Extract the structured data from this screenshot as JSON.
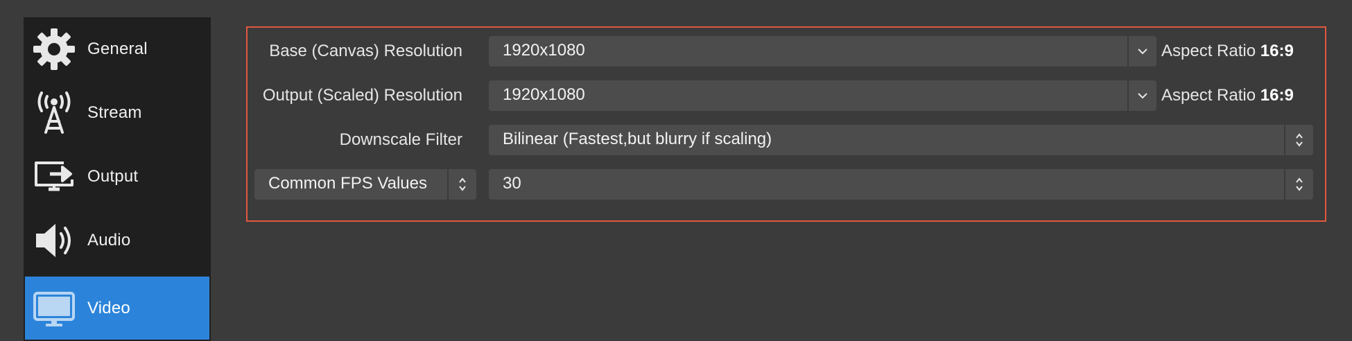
{
  "sidebar": {
    "items": [
      {
        "label": "General",
        "icon": "gear-icon"
      },
      {
        "label": "Stream",
        "icon": "antenna-icon"
      },
      {
        "label": "Output",
        "icon": "monitor-arrow-icon"
      },
      {
        "label": "Audio",
        "icon": "speaker-icon"
      },
      {
        "label": "Video",
        "icon": "monitor-icon",
        "active": true
      }
    ]
  },
  "video": {
    "base_resolution": {
      "label": "Base (Canvas) Resolution",
      "value": "1920x1080",
      "aspect_prefix": "Aspect Ratio",
      "aspect_value": "16:9"
    },
    "output_resolution": {
      "label": "Output (Scaled) Resolution",
      "value": "1920x1080",
      "aspect_prefix": "Aspect Ratio",
      "aspect_value": "16:9"
    },
    "downscale_filter": {
      "label": "Downscale Filter",
      "value": "Bilinear (Fastest,but blurry if scaling)"
    },
    "fps": {
      "type_label": "Common FPS Values",
      "value": "30"
    }
  },
  "colors": {
    "accent": "#2c84da",
    "highlight_border": "#e2583e",
    "background": "#3b3b3b",
    "sidebar": "#1f1f1f",
    "field": "#4c4c4c"
  }
}
